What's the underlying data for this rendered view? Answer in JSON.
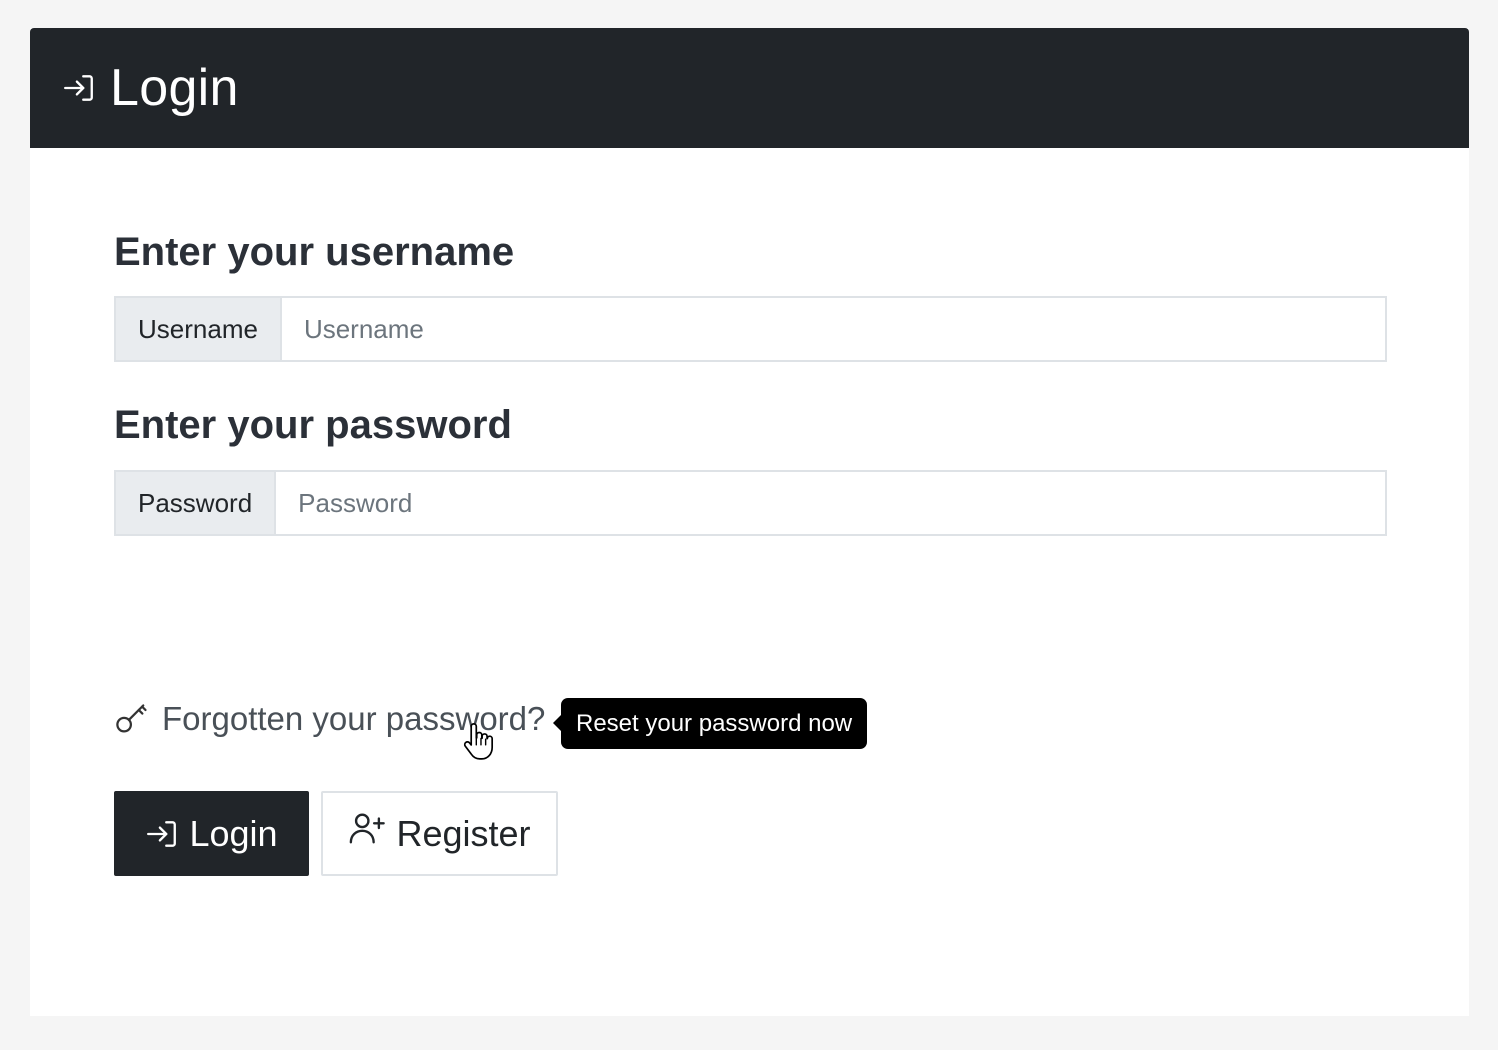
{
  "header": {
    "title": "Login",
    "icon": "login-icon"
  },
  "form": {
    "username_section": "Enter your username",
    "username_addon": "Username",
    "username_placeholder": "Username",
    "username_value": "",
    "password_section": "Enter your password",
    "password_addon": "Password",
    "password_placeholder": "Password",
    "password_value": ""
  },
  "forgot": {
    "icon": "key-icon",
    "label": "Forgotten your password?",
    "tooltip": "Reset your password now"
  },
  "buttons": {
    "login_label": "Login",
    "login_icon": "login-icon",
    "register_label": "Register",
    "register_icon": "person-plus-icon"
  },
  "colors": {
    "header_bg": "#212529",
    "addon_bg": "#e9ecef",
    "page_bg": "#f5f5f5",
    "tooltip_bg": "#000000"
  }
}
